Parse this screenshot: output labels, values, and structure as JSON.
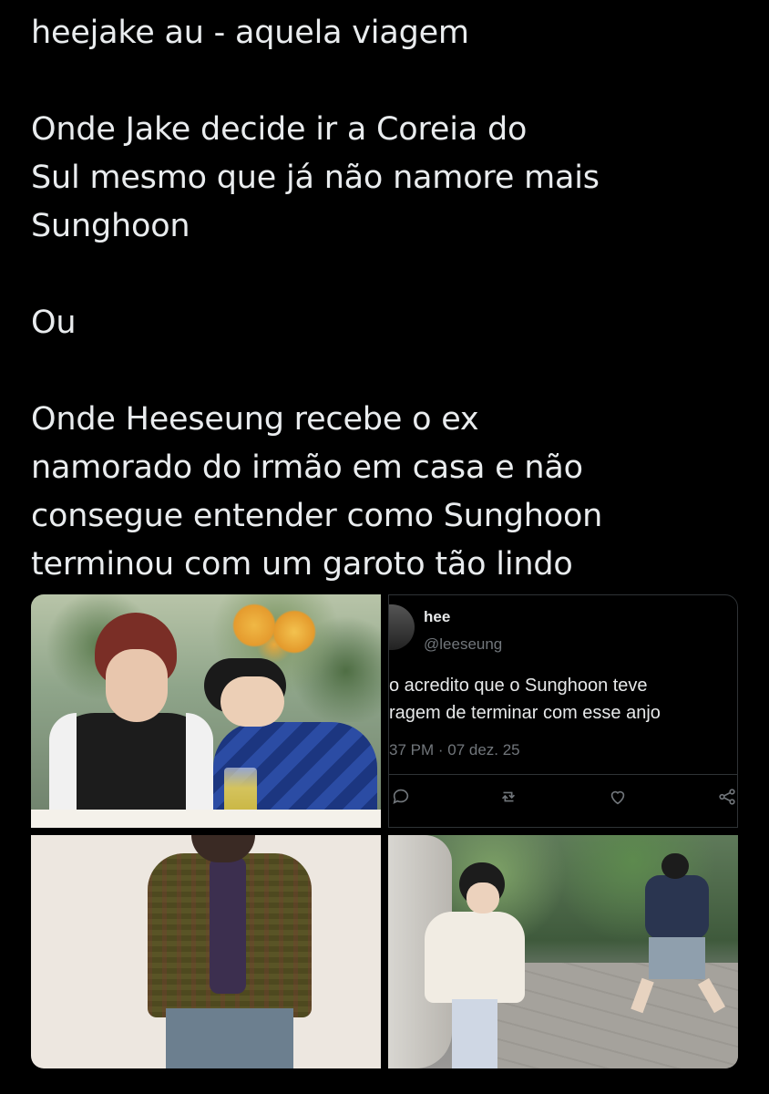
{
  "tweet": {
    "title_line": "heejake au - aquela viagem",
    "para1_line1": "Onde Jake decide ir a Coreia do",
    "para1_line2": "Sul mesmo que já não namore mais",
    "para1_line3": "Sunghoon",
    "para2": "Ou",
    "para3_line1": "Onde Heeseung recebe o ex",
    "para3_line2": "namorado do irmão em casa e não",
    "para3_line3": "consegue entender como Sunghoon",
    "para3_line4": "terminou com um garoto tão lindo"
  },
  "media": {
    "quoted_tweet": {
      "name": "hee",
      "handle": "@leeseung",
      "body_line1": "o acredito que o Sunghoon teve",
      "body_line2": "ragem de terminar com esse anjo",
      "meta": "37 PM · 07 dez. 25",
      "actions": [
        "reply-icon",
        "retweet-icon",
        "like-icon",
        "share-icon"
      ]
    }
  },
  "colors": {
    "background": "#000000",
    "text": "#e9ecee",
    "muted": "#71767b",
    "border": "#2f3336"
  }
}
